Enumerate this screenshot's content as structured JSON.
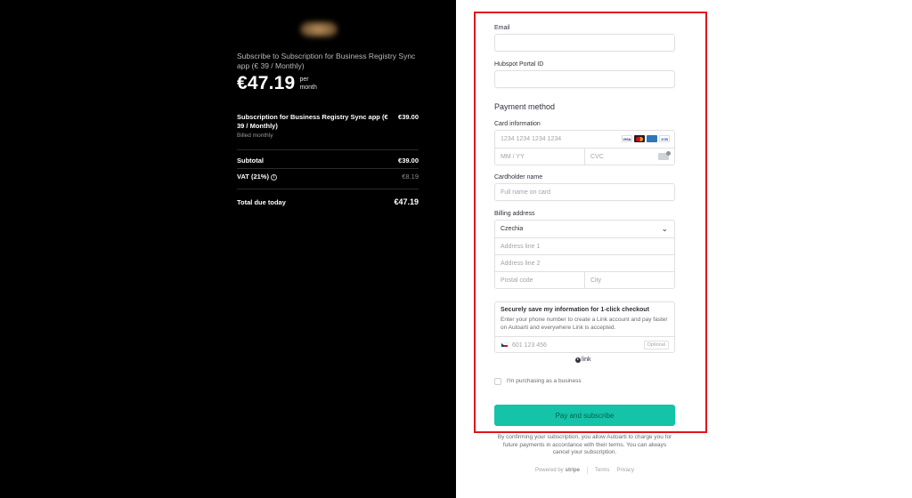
{
  "summary": {
    "title": "Subscribe to Subscription for Business Registry Sync app (€ 39 / Monthly)",
    "price": "€47.19",
    "per_line1": "per",
    "per_line2": "month",
    "item_name": "Subscription for Business Registry Sync app (€ 39 / Monthly)",
    "item_billing": "Billed monthly",
    "item_price": "€39.00",
    "subtotal_label": "Subtotal",
    "subtotal_value": "€39.00",
    "vat_label": "VAT (21%)",
    "vat_value": "€8.19",
    "total_label": "Total due today",
    "total_value": "€47.19"
  },
  "form": {
    "email_label": "Email",
    "email_value": "",
    "portal_label": "Hubspot Portal ID",
    "portal_value": "",
    "payment_title": "Payment method",
    "card_label": "Card information",
    "card_number_placeholder": "1234 1234 1234 1234",
    "expiry_placeholder": "MM / YY",
    "cvc_placeholder": "CVC",
    "card_brands": [
      "VISA",
      "mastercard",
      "AMEX",
      "JCB"
    ],
    "cardholder_label": "Cardholder name",
    "cardholder_placeholder": "Full name on card",
    "billing_label": "Billing address",
    "country": "Czechia",
    "address1_placeholder": "Address line 1",
    "address2_placeholder": "Address line 2",
    "postal_placeholder": "Postal code",
    "city_placeholder": "City"
  },
  "link": {
    "title": "Securely save my information for 1-click checkout",
    "description": "Enter your phone number to create a Link account and pay faster on Autoarti and everywhere Link is accepted.",
    "phone_placeholder": "601 123 456",
    "optional_label": "Optional",
    "logo_text": "link"
  },
  "business_checkbox": {
    "label": "I'm purchasing as a business",
    "checked": false
  },
  "pay_button": "Pay and subscribe",
  "terms": "By confirming your subscription, you allow Autoarti to charge you for future payments in accordance with their terms. You can always cancel your subscription.",
  "footer": {
    "powered_by": "Powered by",
    "stripe": "stripe",
    "terms": "Terms",
    "privacy": "Privacy"
  },
  "colors": {
    "left_bg": "#000000",
    "button_bg": "#14c3a8",
    "highlight_border": "#e0141c"
  }
}
